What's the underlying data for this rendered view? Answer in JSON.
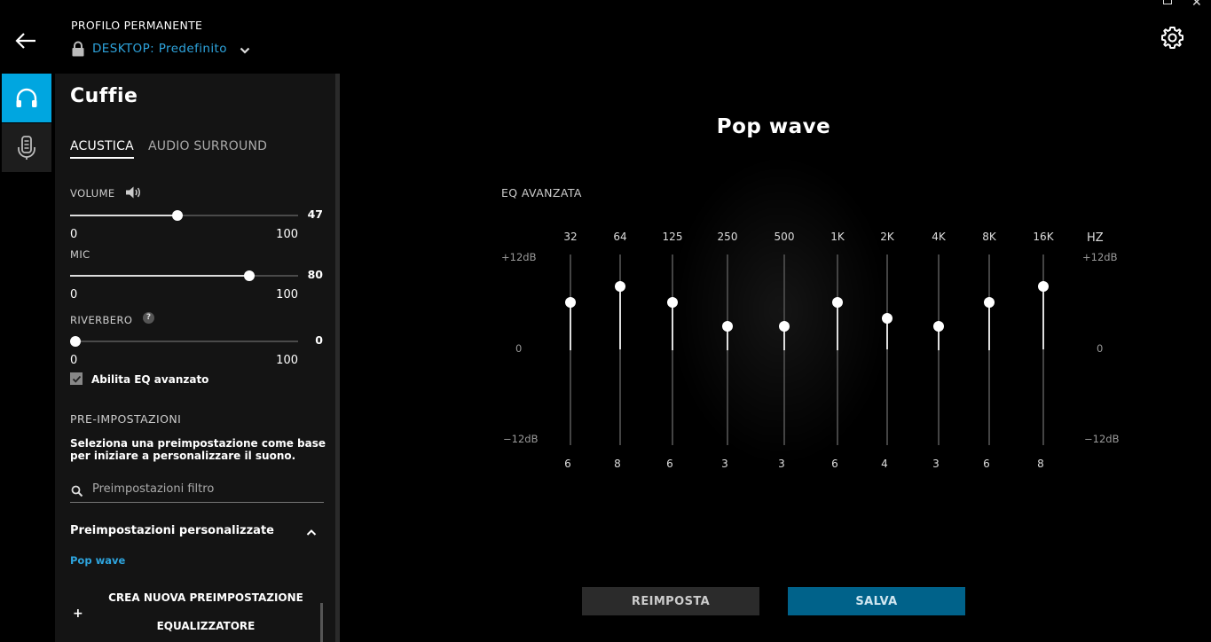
{
  "header": {
    "profile_label": "PROFILO PERMANENTE",
    "profile_name": "DESKTOP: Predefinito"
  },
  "panel": {
    "title": "Cuffie",
    "tabs": [
      {
        "label": "ACUSTICA",
        "active": true
      },
      {
        "label": "AUDIO SURROUND",
        "active": false
      }
    ],
    "sliders": [
      {
        "label": "VOLUME",
        "value": "47",
        "min": "0",
        "max": "100"
      },
      {
        "label": "MIC",
        "value": "80",
        "min": "0",
        "max": "100"
      },
      {
        "label": "RIVERBERO",
        "value": "0",
        "min": "0",
        "max": "100"
      }
    ],
    "help_glyph": "?",
    "advanced_eq_checkbox": {
      "label": "Abilita EQ avanzato",
      "checked": true
    },
    "presets_heading": "PRE-IMPOSTAZIONI",
    "presets_description": "Seleziona una preimpostazione come base per iniziare a personalizzare il suono.",
    "search_placeholder": "Preimpostazioni filtro",
    "custom_presets_heading": "Preimpostazioni personalizzate",
    "custom_presets": [
      "Pop wave"
    ],
    "create_button": {
      "plus": "+",
      "line1": "CREA NUOVA PREIMPOSTAZIONE",
      "line2": "EQUALIZZATORE"
    }
  },
  "main": {
    "title": "Pop wave",
    "eq_title": "EQ AVANZATA",
    "hz_label": "HZ",
    "db_top": "+12dB",
    "db_mid": "0",
    "db_bottom": "−12dB",
    "bands": [
      {
        "freq": "32",
        "value": "6",
        "db": 6
      },
      {
        "freq": "64",
        "value": "8",
        "db": 8
      },
      {
        "freq": "125",
        "value": "6",
        "db": 6
      },
      {
        "freq": "250",
        "value": "3",
        "db": 3
      },
      {
        "freq": "500",
        "value": "3",
        "db": 3
      },
      {
        "freq": "1K",
        "value": "6",
        "db": 6
      },
      {
        "freq": "2K",
        "value": "4",
        "db": 4
      },
      {
        "freq": "4K",
        "value": "3",
        "db": 3
      },
      {
        "freq": "8K",
        "value": "6",
        "db": 6
      },
      {
        "freq": "16K",
        "value": "8",
        "db": 8
      }
    ],
    "reset_label": "REIMPOSTA",
    "save_label": "SALVA"
  },
  "colors": {
    "accent": "#00a6e0",
    "link": "#2ea4dd",
    "save_button": "#00628a"
  }
}
